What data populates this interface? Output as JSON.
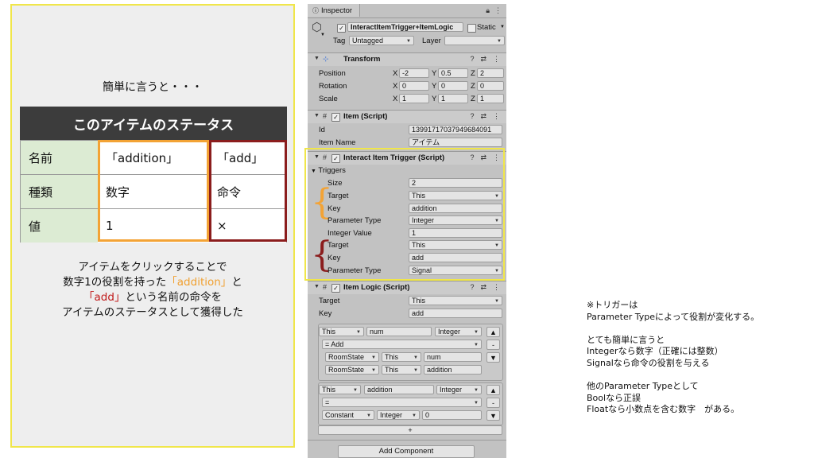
{
  "left": {
    "heading": "簡単に言うと・・・",
    "table": {
      "header": "このアイテムのステータス",
      "rows": [
        [
          "名前",
          "「addition」",
          "「add」"
        ],
        [
          "種類",
          "数字",
          "命令"
        ],
        [
          "値",
          "1",
          "×"
        ]
      ]
    },
    "explain": {
      "line1": "アイテムをクリックすることで",
      "line2_a": "数字1の役割を持った",
      "line2_b": "「addition」",
      "line2_c": "と",
      "line3_a": "「add」",
      "line3_b": "という名前の命令を",
      "line4": "アイテムのステータスとして獲得した"
    },
    "colors": {
      "panel_border": "#f0e64a",
      "orange": "#f3a335",
      "dark_red": "#8b1d1d",
      "header_bg": "#3c3c3c",
      "label_bg": "#dcebd3"
    }
  },
  "inspector": {
    "tab_label": "Inspector",
    "object_name": "InteractItemTrigger+ItemLogic",
    "static_label": "Static",
    "tag_label": "Tag",
    "tag_value": "Untagged",
    "layer_label": "Layer",
    "layer_value": "",
    "transform": {
      "title": "Transform",
      "position_label": "Position",
      "position": [
        "-2",
        "0.5",
        "2"
      ],
      "rotation_label": "Rotation",
      "rotation": [
        "0",
        "0",
        "0"
      ],
      "scale_label": "Scale",
      "scale": [
        "1",
        "1",
        "1"
      ],
      "axis": [
        "X",
        "Y",
        "Z"
      ]
    },
    "item": {
      "title": "Item (Script)",
      "id_label": "Id",
      "id_value": "13991717037949684091",
      "name_label": "Item Name",
      "name_value": "アイテム"
    },
    "trigger": {
      "title": "Interact Item Trigger (Script)",
      "triggers_label": "Triggers",
      "size_label": "Size",
      "size_value": "2",
      "t1": {
        "target_label": "Target",
        "target_value": "This",
        "key_label": "Key",
        "key_value": "addition",
        "ptype_label": "Parameter Type",
        "ptype_value": "Integer",
        "ivalue_label": "Integer Value",
        "ivalue_value": "1"
      },
      "t2": {
        "target_label": "Target",
        "target_value": "This",
        "key_label": "Key",
        "key_value": "add",
        "ptype_label": "Parameter Type",
        "ptype_value": "Signal"
      }
    },
    "logic": {
      "title": "Item Logic (Script)",
      "target_label": "Target",
      "target_value": "This",
      "key_label": "Key",
      "key_value": "add",
      "block1": {
        "r1": [
          "This",
          "num",
          "Integer"
        ],
        "r2": "= Add",
        "r3": [
          "RoomState",
          "This",
          "num"
        ],
        "r4": [
          "RoomState",
          "This",
          "addition"
        ]
      },
      "block2": {
        "r1": [
          "This",
          "addition",
          "Integer"
        ],
        "r2": "=",
        "r3": [
          "Constant",
          "Integer",
          "0"
        ]
      },
      "plus": "+",
      "minus": "-",
      "up": "▲",
      "down": "▼"
    },
    "add_component": "Add Component"
  },
  "note": {
    "l1": "※トリガーは",
    "l2": "Parameter Typeによって役割が変化する。",
    "l3": "とても簡単に言うと",
    "l4": "Integerなら数字（正確には整数）",
    "l5": "Signalなら命令の役割を与える",
    "l6": "他のParameter Typeとして",
    "l7": "Boolなら正誤",
    "l8": "Floatなら小数点を含む数字　がある。"
  }
}
